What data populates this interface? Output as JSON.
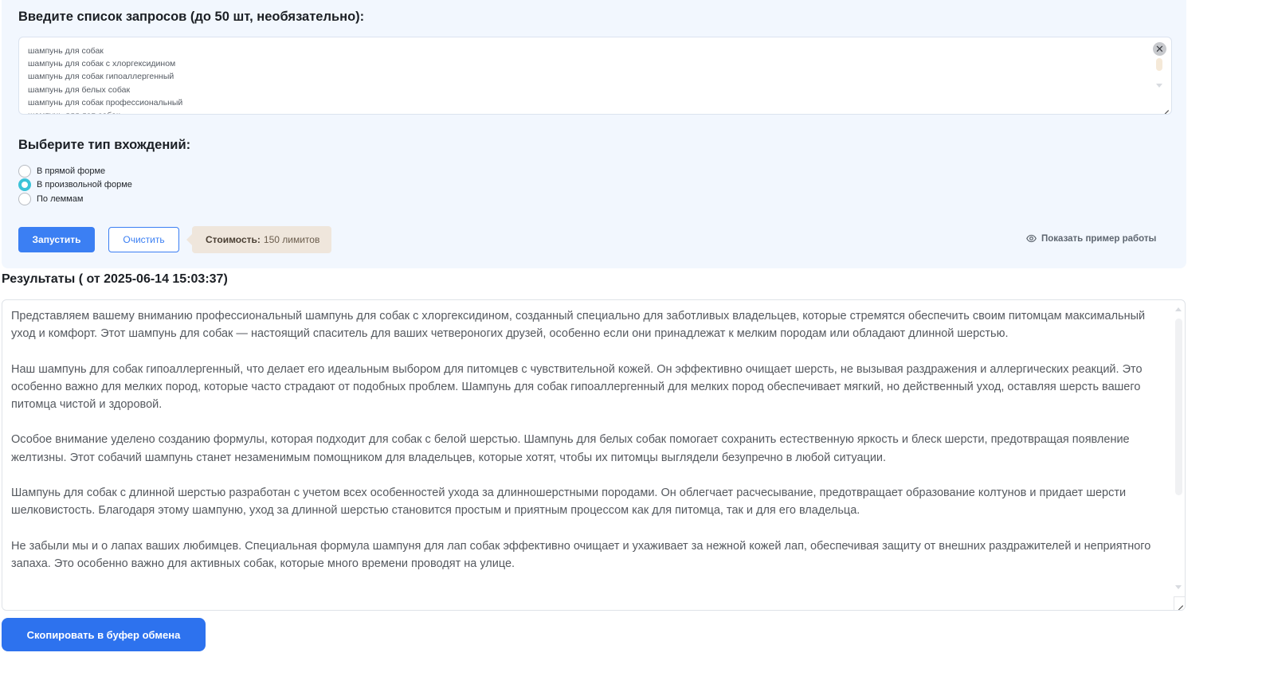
{
  "queries": {
    "title": "Введите список запросов (до 50 шт, необязательно):",
    "text": "шампунь для собак\nшампунь для собак с хлоргексидином\nшампунь для собак гипоаллергенный\nшампунь для белых собак\nшампунь для собак профессиональный\nшампунь для лап собак",
    "clear_symbol": "✕"
  },
  "occurrence_type": {
    "title": "Выберите тип вхождений:",
    "options": [
      {
        "label": "В прямой форме",
        "checked": false
      },
      {
        "label": "В произвольной форме",
        "checked": true
      },
      {
        "label": "По леммам",
        "checked": false
      }
    ]
  },
  "actions": {
    "run_label": "Запустить",
    "clear_label": "Очистить",
    "cost_label": "Стоимость:",
    "cost_value": "150 лимитов",
    "show_example_label": "Показать пример работы"
  },
  "results": {
    "title": "Результаты ( от 2025-06-14 15:03:37)",
    "paragraphs": [
      "Представляем вашему вниманию профессиональный шампунь для собак с хлоргексидином, созданный специально для заботливых владельцев, которые стремятся обеспечить своим питомцам максимальный уход и комфорт. Этот шампунь для собак — настоящий спаситель для ваших четвероногих друзей, особенно если они принадлежат к мелким породам или обладают длинной шерстью.",
      "Наш шампунь для собак гипоаллергенный, что делает его идеальным выбором для питомцев с чувствительной кожей. Он эффективно очищает шерсть, не вызывая раздражения и аллергических реакций. Это особенно важно для мелких пород, которые часто страдают от подобных проблем. Шампунь для собак гипоаллергенный для мелких пород обеспечивает мягкий, но действенный уход, оставляя шерсть вашего питомца чистой и здоровой.",
      "Особое внимание уделено созданию формулы, которая подходит для собак с белой шерстью. Шампунь для белых собак помогает сохранить естественную яркость и блеск шерсти, предотвращая появление желтизны. Этот собачий шампунь станет незаменимым помощником для владельцев, которые хотят, чтобы их питомцы выглядели безупречно в любой ситуации.",
      "Шампунь для собак с длинной шерстью разработан с учетом всех особенностей ухода за длинношерстными породами. Он облегчает расчесывание, предотвращает образование колтунов и придает шерсти шелковистость. Благодаря этому шампуню, уход за длинной шерстью становится простым и приятным процессом как для питомца, так и для его владельца.",
      "Не забыли мы и о лапах ваших любимцев. Специальная формула шампуня для лап собак эффективно очищает и ухаживает за нежной кожей лап, обеспечивая защиту от внешних раздражителей и неприятного запаха. Это особенно важно для активных собак, которые много времени проводят на улице."
    ]
  },
  "copy": {
    "label": "Скопировать в буфер обмена"
  }
}
